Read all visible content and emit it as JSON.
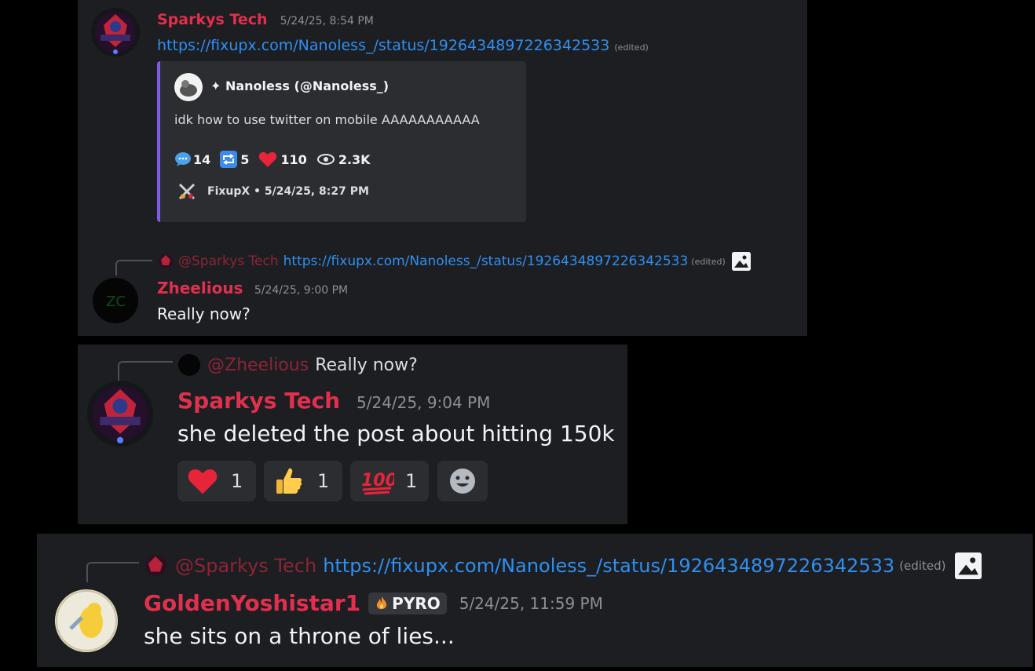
{
  "message1": {
    "author": "Sparkys Tech",
    "timestamp": "5/24/25, 8:54 PM",
    "link": "https://fixupx.com/Nanoless_/status/1926434897226342533",
    "edited": "(edited)",
    "embed": {
      "author": "✦ Nanoless (@Nanoless_)",
      "text": "idk how to use twitter on mobile AAAAAAAAAAA",
      "stats": {
        "replies": "14",
        "retweets": "5",
        "likes": "110",
        "views": "2.3K"
      },
      "footer": "FixupX • 5/24/25, 8:27 PM",
      "accent_color": "#7f5af0"
    }
  },
  "message2": {
    "reply": {
      "author": "@Sparkys Tech",
      "link": "https://fixupx.com/Nanoless_/status/1926434897226342533",
      "edited": "(edited)"
    },
    "author": "Zheelious",
    "timestamp": "5/24/25, 9:00 PM",
    "text": "Really now?"
  },
  "message3": {
    "reply": {
      "author": "@Zheelious",
      "text": "Really now?"
    },
    "author": "Sparkys Tech",
    "timestamp": "5/24/25, 9:04 PM",
    "text": "she deleted the post about hitting 150k",
    "reactions": [
      {
        "icon": "heart-emoji-icon",
        "count": "1"
      },
      {
        "icon": "thumbs-up-emoji-icon",
        "count": "1"
      },
      {
        "icon": "hundred-points-emoji-icon",
        "count": "1"
      }
    ]
  },
  "message4": {
    "reply": {
      "author": "@Sparkys Tech",
      "link": "https://fixupx.com/Nanoless_/status/1926434897226342533",
      "edited": "(edited)"
    },
    "author": "GoldenYoshistar1",
    "tag": "PYRO",
    "timestamp": "5/24/25, 11:59 PM",
    "text": "she sits on a throne of lies..."
  },
  "colors": {
    "username": "#e0304e",
    "link": "#2f8ff0",
    "background": "#1d1e22"
  }
}
